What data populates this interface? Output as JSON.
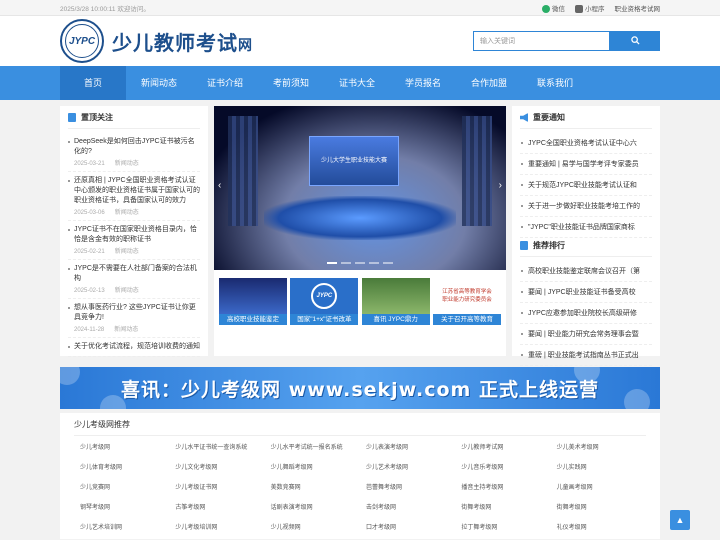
{
  "topbar": {
    "datetime": "2025/3/28 10:00:11 欢迎访问。",
    "wechat": "微信",
    "miniprogram": "小程序",
    "cert_link": "职业资格考试网"
  },
  "header": {
    "logo_badge": "JYPC",
    "site_name": "少儿教师考试",
    "site_suffix": "网",
    "search_placeholder": "输入关键词",
    "search_icon": "search-icon"
  },
  "nav": [
    "首页",
    "新闻动态",
    "证书介绍",
    "考前须知",
    "证书大全",
    "学员报名",
    "合作加盟",
    "联系我们"
  ],
  "left": {
    "title": "置顶关注",
    "items": [
      {
        "title": "DeepSeek是如何回击JYPC证书被污名化的?",
        "date": "2025-03-21",
        "cat": "新闻动态"
      },
      {
        "title": "还原真相 | JYPC全国职业资格考试认证中心颁发的职业资格证书属于国家认可的职业资格证书，具备国家认可的效力",
        "date": "2025-03-06",
        "cat": "新闻动态"
      },
      {
        "title": "JYPC证书不在国家职业资格目录内，恰恰是含金有效的职称证书",
        "date": "2025-02-21",
        "cat": "新闻动态"
      },
      {
        "title": "JYPC是不需要在人社部门备案的合法机构",
        "date": "2025-02-13",
        "cat": "新闻动态"
      },
      {
        "title": "想从事医药行业? 这些JYPC证书让你更具竞争力!",
        "date": "2024-11-28",
        "cat": "新闻动态"
      },
      {
        "title": "关于优化考试流程，规范培训收费的通知",
        "date": "",
        "cat": ""
      }
    ]
  },
  "center": {
    "slide_text": "少儿大学生职业技能大赛",
    "thumbs": [
      {
        "caption": "高校职业技能鉴定"
      },
      {
        "caption": "国家\"1+x\"证书改革"
      },
      {
        "caption": "喜讯 JYPC鼎力"
      },
      {
        "caption": "关于召开高等教育"
      }
    ],
    "thumb4_text": [
      "江苏省高等教育学会",
      "职业能力研究委员会"
    ]
  },
  "right": {
    "notice_title": "重要通知",
    "notices": [
      "JYPC全国职业资格考试认证中心六",
      "重要通知 | 易学与国学考评专家委员",
      "关于规范JYPC职业技能考试认证和",
      "关于进一步做好职业技能考培工作的",
      "\"JYPC\"职业技能证书品牌国家商标"
    ],
    "rank_title": "推荐排行",
    "ranks": [
      "高校职业技能鉴定联席会议召开（第",
      "要闻 | JYPC职业技能证书备受高校",
      "JYPC应邀参加职业院校长高级研修",
      "要闻 | 职业能力研究会常务理事会暨",
      "重磅 | 职业技能考试指南丛书正式出"
    ]
  },
  "banner": {
    "text": "喜讯：少儿考级网 www.sekjw.com 正式上线运营"
  },
  "links": {
    "title": "少儿考级网推荐",
    "items": [
      "少儿考级网",
      "少儿水平证书统一查询系统",
      "少儿水平考试统一报名系统",
      "少儿表演考级网",
      "少儿教师考试网",
      "少儿美术考级网",
      "少儿体育考级网",
      "少儿文化考级网",
      "少儿舞蹈考级网",
      "少儿艺术考级网",
      "少儿音乐考级网",
      "少儿实践网",
      "少儿竞赛网",
      "少儿考级证书网",
      "美数竞赛网",
      "芭蕾舞考级网",
      "播音主持考级网",
      "儿童画考级网",
      "钢琴考级网",
      "古筝考级网",
      "话剧表演考级网",
      "击剑考级网",
      "街舞考级网",
      "街舞考级网",
      "少儿艺术培训网",
      "少儿考级培训网",
      "少儿视频网",
      "口才考级网",
      "拉丁舞考级网",
      "礼仪考级网"
    ]
  },
  "totop": "▲"
}
